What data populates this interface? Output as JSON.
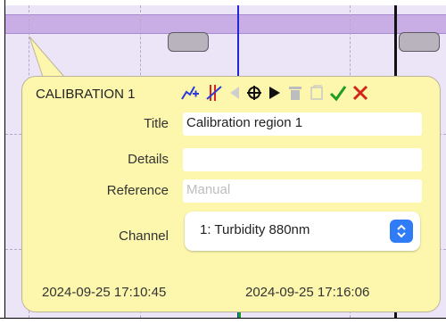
{
  "dialog": {
    "title": "CALIBRATION 1",
    "fields": {
      "title_label": "Title",
      "title_value": "Calibration region 1",
      "details_label": "Details",
      "details_value": "",
      "reference_label": "Reference",
      "reference_value": "",
      "reference_placeholder": "Manual",
      "channel_label": "Channel",
      "channel_value": "1: Turbidity 880nm"
    },
    "start_time": "2024-09-25 17:10:45",
    "end_time": "2024-09-25 17:16:06",
    "toolbar_icons": [
      "add-point-icon",
      "add-marker-icon",
      "previous-icon",
      "locate-icon",
      "next-icon",
      "delete-icon",
      "copy-icon",
      "confirm-icon",
      "close-icon"
    ]
  },
  "colors": {
    "popup_background": "#fcf7ad",
    "region_band": "#ece5f7",
    "region_header": "#c9aee6",
    "blue_marker": "#2326d6",
    "green_marker": "#14a314",
    "confirm": "#1f9d1f",
    "close": "#d4251c",
    "select_accent": "#2f7cf6"
  }
}
